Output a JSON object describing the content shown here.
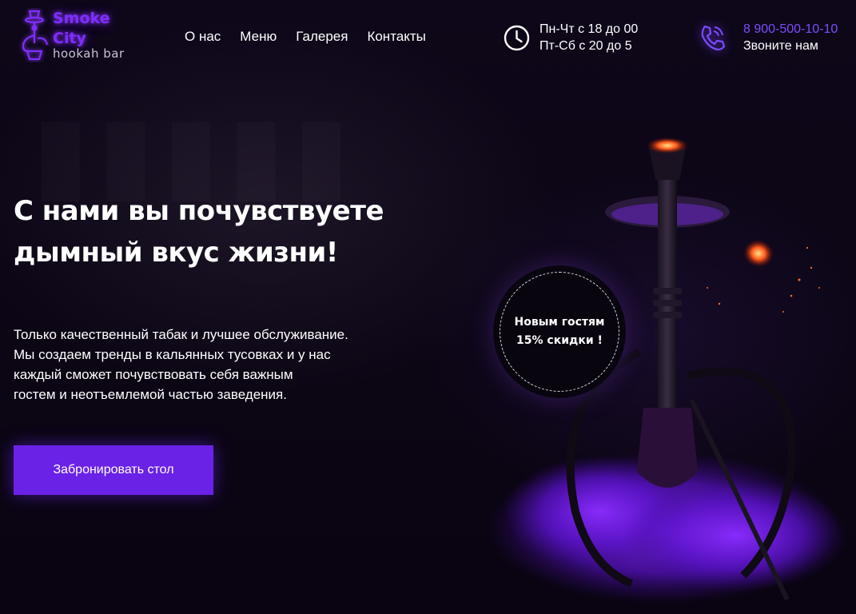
{
  "brand": {
    "name_line1": "Smoke",
    "name_line2": "City",
    "subtitle": "hookah bar",
    "accent_color": "#7f2dff"
  },
  "nav": {
    "items": [
      {
        "label": "О нас"
      },
      {
        "label": "Меню"
      },
      {
        "label": "Галерея"
      },
      {
        "label": "Контакты"
      }
    ]
  },
  "hours": {
    "icon": "clock-icon",
    "line1": "Пн-Чт с 18 до 00",
    "line2": "Пт-Сб с 20 до 5"
  },
  "contact": {
    "icon": "phone-icon",
    "phone": "8 900-500-10-10",
    "cta": "Звоните нам",
    "phone_color": "#7a4dff"
  },
  "hero": {
    "title_line1": "С нами вы почувствуете",
    "title_line2": "дымный вкус жизни!",
    "desc_lines": [
      "Только качественный табак и лучшее обслуживание.",
      "Мы создаем тренды в кальянных тусовках и у нас",
      "каждый сможет почувствовать себя важным",
      "гостем и неотъемлемой частью заведения."
    ],
    "button_label": "Забронировать стол",
    "button_color": "#6a22e6"
  },
  "promo": {
    "line1": "Новым гостям",
    "line2": "15% скидки !"
  }
}
